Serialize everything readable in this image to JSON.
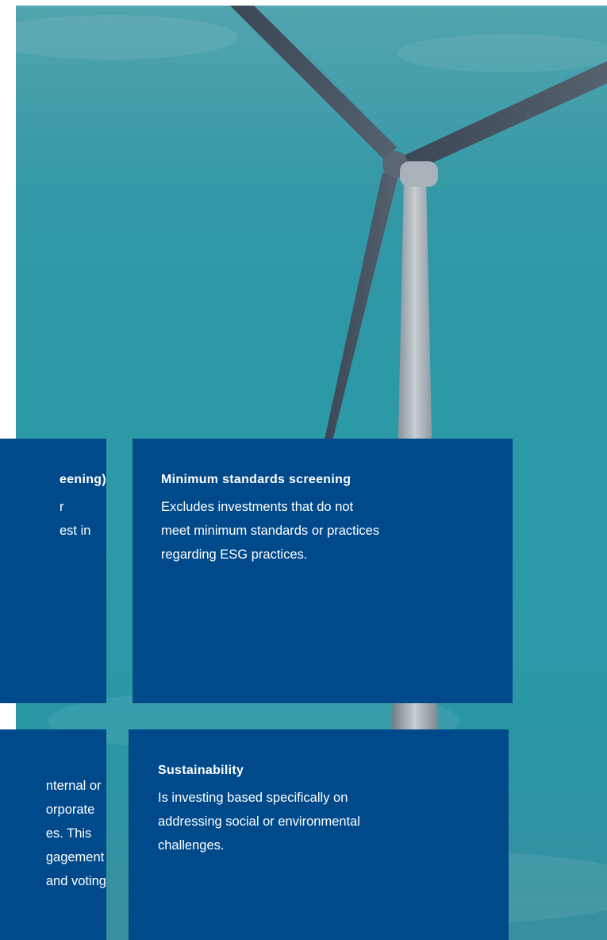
{
  "colors": {
    "card_bg": "#004a8c",
    "sky": "#2e98a6",
    "text": "#ffffff"
  },
  "photo": {
    "icon": "wind-turbine-photo"
  },
  "cards": {
    "top_left": {
      "title": "eening)",
      "lines": [
        "r",
        "est in"
      ]
    },
    "top_right": {
      "title": "Minimum standards screening",
      "lines": [
        "Excludes investments that do not",
        "meet minimum standards or practices",
        "regarding ESG practices."
      ]
    },
    "bottom_left": {
      "lines": [
        "nternal or",
        "orporate",
        "es. This",
        "gagement",
        "and voting"
      ]
    },
    "bottom_right": {
      "title": "Sustainability",
      "lines": [
        "Is investing based specifically on",
        "addressing social or environmental",
        "challenges."
      ]
    }
  }
}
